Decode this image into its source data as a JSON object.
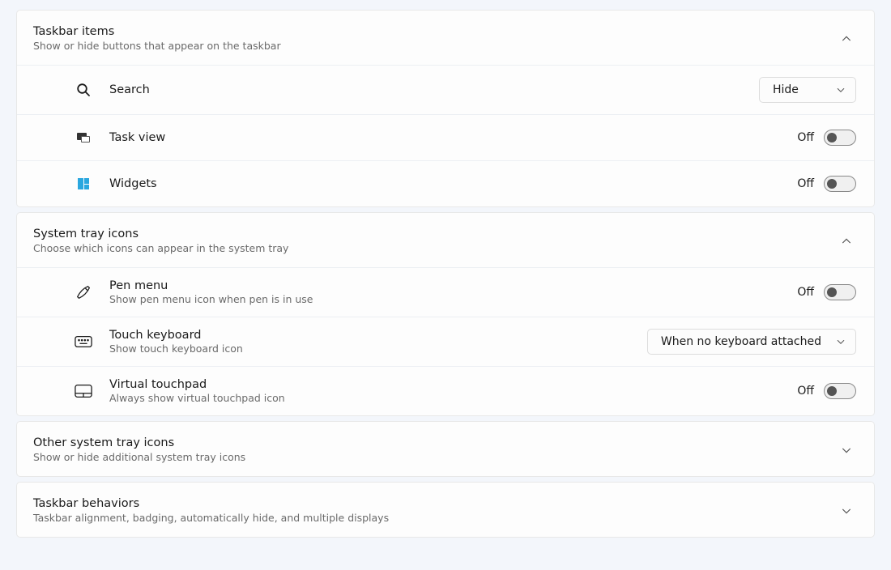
{
  "sections": {
    "taskbar_items": {
      "title": "Taskbar items",
      "subtitle": "Show or hide buttons that appear on the taskbar",
      "search": {
        "label": "Search",
        "dropdown_value": "Hide"
      },
      "taskview": {
        "label": "Task view",
        "state": "Off"
      },
      "widgets": {
        "label": "Widgets",
        "state": "Off"
      }
    },
    "system_tray": {
      "title": "System tray icons",
      "subtitle": "Choose which icons can appear in the system tray",
      "pen": {
        "label": "Pen menu",
        "sub": "Show pen menu icon when pen is in use",
        "state": "Off"
      },
      "touchkb": {
        "label": "Touch keyboard",
        "sub": "Show touch keyboard icon",
        "dropdown_value": "When no keyboard attached"
      },
      "vtouch": {
        "label": "Virtual touchpad",
        "sub": "Always show virtual touchpad icon",
        "state": "Off"
      }
    },
    "other_tray": {
      "title": "Other system tray icons",
      "subtitle": "Show or hide additional system tray icons"
    },
    "behaviors": {
      "title": "Taskbar behaviors",
      "subtitle": "Taskbar alignment, badging, automatically hide, and multiple displays"
    }
  }
}
